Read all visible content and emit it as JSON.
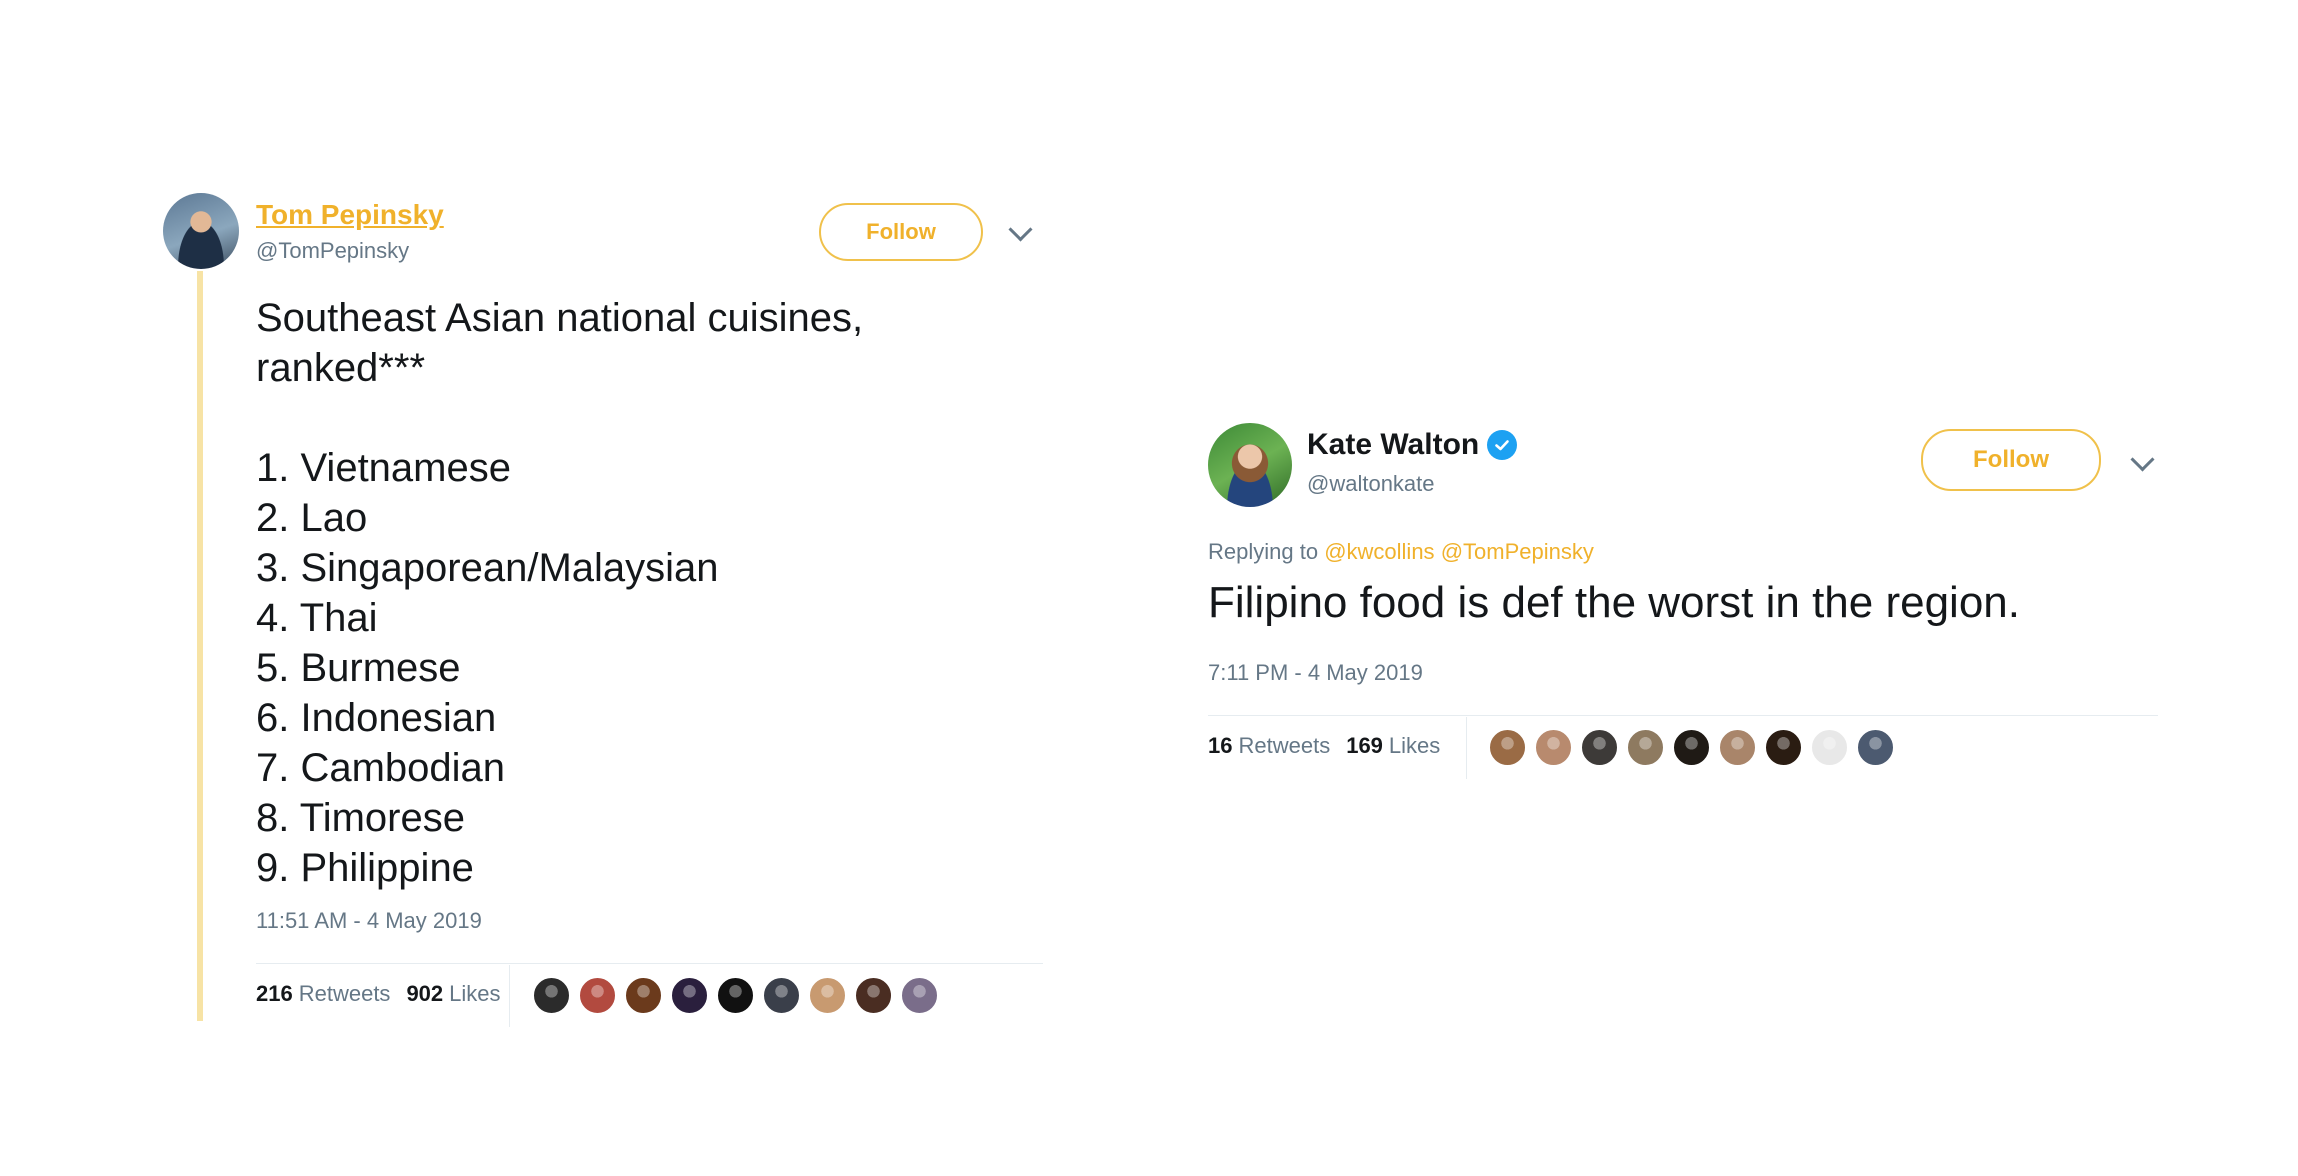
{
  "tweets": [
    {
      "author_name": "Tom Pepinsky",
      "author_handle": "@TomPepinsky",
      "follow_label": "Follow",
      "intro": "Southeast Asian national cuisines,\nranked***",
      "ranking": [
        "1. Vietnamese",
        "2. Lao",
        "3. Singaporean/Malaysian",
        "4. Thai",
        "5. Burmese",
        "6. Indonesian",
        "7. Cambodian",
        "8. Timorese",
        "9. Philippine"
      ],
      "timestamp": "11:51 AM - 4 May 2019",
      "retweets_count": "216",
      "retweets_label": "Retweets",
      "likes_count": "902",
      "likes_label": "Likes",
      "liker_colors": [
        "#2b2b2b",
        "#b24a3f",
        "#6b3a1c",
        "#2a1f3d",
        "#111111",
        "#3a3f4a",
        "#c89a70",
        "#4a2d22",
        "#7a6d8a"
      ]
    },
    {
      "author_name": "Kate Walton",
      "author_handle": "@waltonkate",
      "verified": true,
      "follow_label": "Follow",
      "replying_prefix": "Replying to",
      "replying_mentions": [
        "@kwcollins",
        "@TomPepinsky"
      ],
      "text": "Filipino food is def the worst in the region.",
      "timestamp": "7:11 PM - 4 May 2019",
      "retweets_count": "16",
      "retweets_label": "Retweets",
      "likes_count": "169",
      "likes_label": "Likes",
      "liker_colors": [
        "#9a6b45",
        "#b88a6e",
        "#3d3a38",
        "#8e7a60",
        "#1f1a15",
        "#a9856a",
        "#2a1c12",
        "#e8e8e8",
        "#4c5a70"
      ]
    }
  ],
  "colors": {
    "accent": "#f0b12b",
    "thread_line": "#f7e3a5",
    "verified": "#1da1f2",
    "muted_text": "#657786"
  }
}
